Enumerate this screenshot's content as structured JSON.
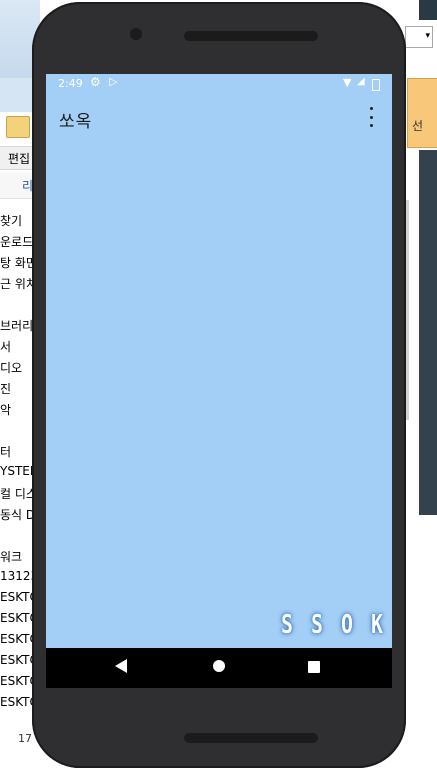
{
  "explorer_left": {
    "menu_label": "편집",
    "column_label": "리",
    "items": [
      "찾기",
      "운로드",
      "탕 화면",
      "근 위치",
      "",
      "브러리",
      "서",
      "디오",
      "진",
      "악",
      "",
      "터",
      "YSTEM",
      "컬 디스",
      "동식 D",
      "",
      "워크",
      "13123",
      "ESKTO",
      "ESKTO",
      "ESKTO",
      "ESKTO",
      "ESKTO",
      "ESKTO"
    ],
    "bottom_count": "17"
  },
  "explorer_right": {
    "button_label": "선"
  },
  "phone": {
    "status_bar": {
      "time": "2:49"
    },
    "app_bar": {
      "title": "쏘옥"
    },
    "logo_letters": [
      "S",
      "S",
      "O",
      "K"
    ]
  }
}
